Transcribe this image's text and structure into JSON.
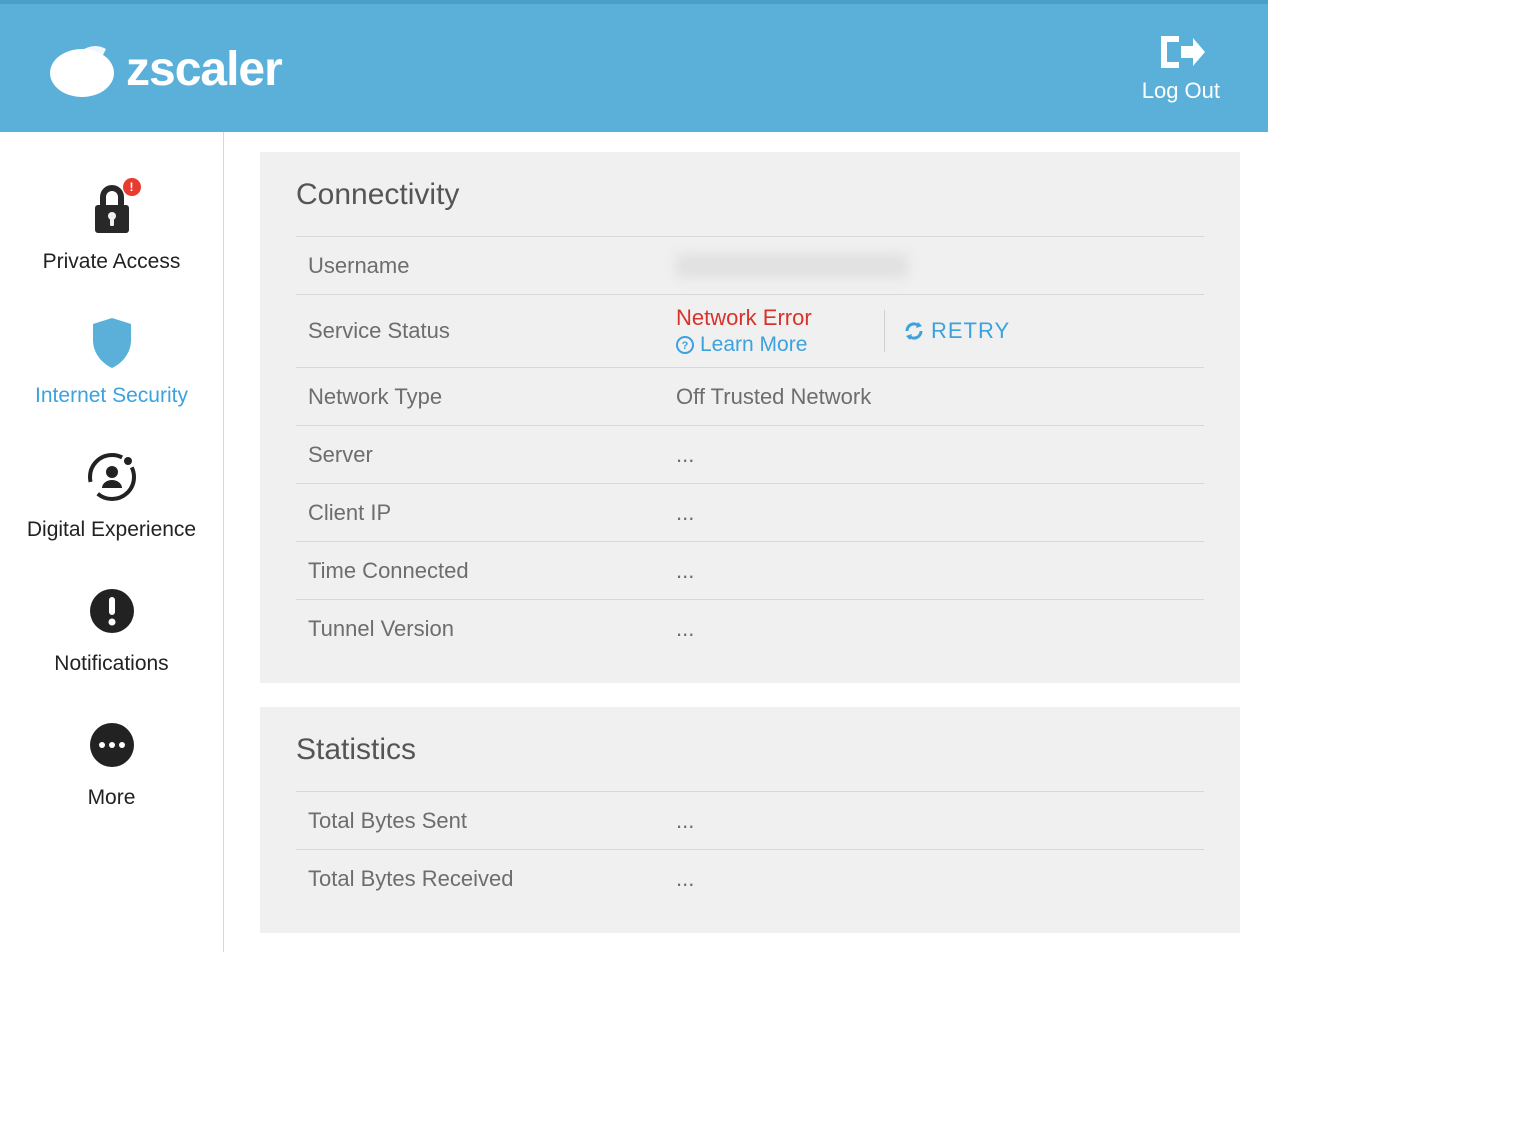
{
  "header": {
    "brand": "zscaler",
    "logout_label": "Log Out"
  },
  "sidebar": {
    "items": [
      {
        "label": "Private Access"
      },
      {
        "label": "Internet Security"
      },
      {
        "label": "Digital Experience"
      },
      {
        "label": "Notifications"
      },
      {
        "label": "More"
      }
    ]
  },
  "connectivity": {
    "title": "Connectivity",
    "username_label": "Username",
    "username_value": "",
    "service_status_label": "Service Status",
    "service_status_value": "Network Error",
    "learn_more_label": "Learn More",
    "retry_label": "RETRY",
    "network_type_label": "Network Type",
    "network_type_value": "Off Trusted Network",
    "server_label": "Server",
    "server_value": "...",
    "client_ip_label": "Client IP",
    "client_ip_value": "...",
    "time_connected_label": "Time Connected",
    "time_connected_value": "...",
    "tunnel_version_label": "Tunnel Version",
    "tunnel_version_value": "..."
  },
  "statistics": {
    "title": "Statistics",
    "total_bytes_sent_label": "Total Bytes Sent",
    "total_bytes_sent_value": "...",
    "total_bytes_received_label": "Total Bytes Received",
    "total_bytes_received_value": "..."
  }
}
